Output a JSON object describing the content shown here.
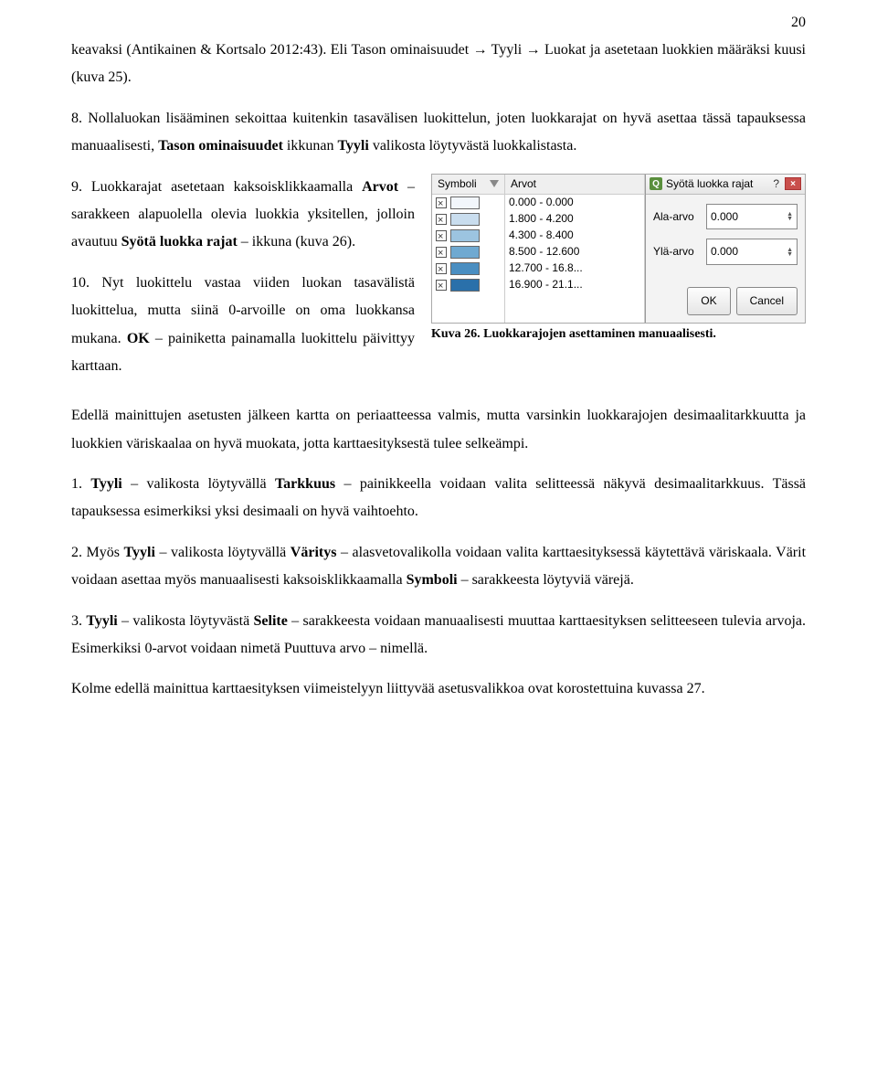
{
  "page_number": "20",
  "para1_a": "keavaksi (Antikainen & Kortsalo 2012:43). Eli Tason ominaisuudet → Tyyli → Luokat ja asetetaan luokkien määräksi kuusi (kuva 25).",
  "para2_a": "8. Nollaluokan lisääminen sekoittaa kuitenkin tasavälisen luokittelun, joten luokkarajat on hyvä asettaa tässä tapauksessa manuaalisesti, ",
  "para2_b": "Tason ominaisuudet",
  "para2_c": " ikkunan ",
  "para2_d": "Tyyli",
  "para2_e": " valikosta löytyvästä luokkalistasta.",
  "para3_a": "9. Luokkarajat asetetaan kaksoisklikkaamalla ",
  "para3_b": "Arvot",
  "para3_c": " – sarakkeen alapuolella olevia luokkia yksitellen, jolloin avautuu ",
  "para3_d": "Syötä luokka rajat",
  "para3_e": " – ikkuna (kuva 26).",
  "para4_a": "10. Nyt luokittelu vastaa viiden luokan tasavälistä luokittelua, mutta siinä 0-arvoille on oma luokkansa mukana. ",
  "para4_b": "OK",
  "para4_c": " – painiketta painamalla luokittelu päivittyy karttaan.",
  "para5": "Edellä mainittujen asetusten jälkeen kartta on periaatteessa valmis, mutta varsinkin luokkarajojen desimaalitarkkuutta ja luokkien väriskaalaa on hyvä muokata, jotta karttaesityksestä tulee selkeämpi.",
  "para6_a": "1. ",
  "para6_b": "Tyyli",
  "para6_c": " – valikosta löytyvällä ",
  "para6_d": "Tarkkuus",
  "para6_e": " – painikkeella voidaan valita selitteessä näkyvä desimaalitarkkuus. Tässä tapauksessa esimerkiksi yksi desimaali on hyvä vaihtoehto.",
  "para7_a": "2. Myös ",
  "para7_b": "Tyyli",
  "para7_c": " – valikosta löytyvällä ",
  "para7_d": "Väritys",
  "para7_e": " – alasvetovalikolla voidaan valita karttaesityksessä käytettävä väriskaala. Värit voidaan asettaa myös manuaalisesti kaksoisklikkaamalla ",
  "para7_f": "Symboli",
  "para7_g": " – sarakkeesta löytyviä värejä.",
  "para8_a": "3. ",
  "para8_b": "Tyyli",
  "para8_c": " – valikosta löytyvästä ",
  "para8_d": "Selite",
  "para8_e": " – sarakkeesta voidaan manuaalisesti muuttaa karttaesityksen selitteeseen tulevia arvoja. Esimerkiksi 0-arvot voidaan nimetä Puuttuva arvo – nimellä.",
  "para9": "Kolme edellä mainittua karttaesityksen viimeistelyyn liittyvää asetusvalikkoa ovat korostettuina kuvassa 27.",
  "figure": {
    "caption": "Kuva 26. Luokkarajojen asettaminen manuaalisesti.",
    "col_symboli": "Symboli",
    "col_arvot": "Arvot",
    "popup_title": "Syötä luokka rajat",
    "ala_label": "Ala-arvo",
    "yla_label": "Ylä-arvo",
    "ala_value": "0.000",
    "yla_value": "0.000",
    "ok": "OK",
    "cancel": "Cancel",
    "rows": [
      {
        "color": "#f2f6fb",
        "range": "0.000 - 0.000"
      },
      {
        "color": "#c9ddee",
        "range": "1.800 - 4.200"
      },
      {
        "color": "#9cc4e0",
        "range": "4.300 - 8.400"
      },
      {
        "color": "#6fa9d1",
        "range": "8.500 - 12.600"
      },
      {
        "color": "#4a8ec1",
        "range": "12.700 - 16.8..."
      },
      {
        "color": "#2a70aa",
        "range": "16.900 - 21.1..."
      }
    ]
  }
}
